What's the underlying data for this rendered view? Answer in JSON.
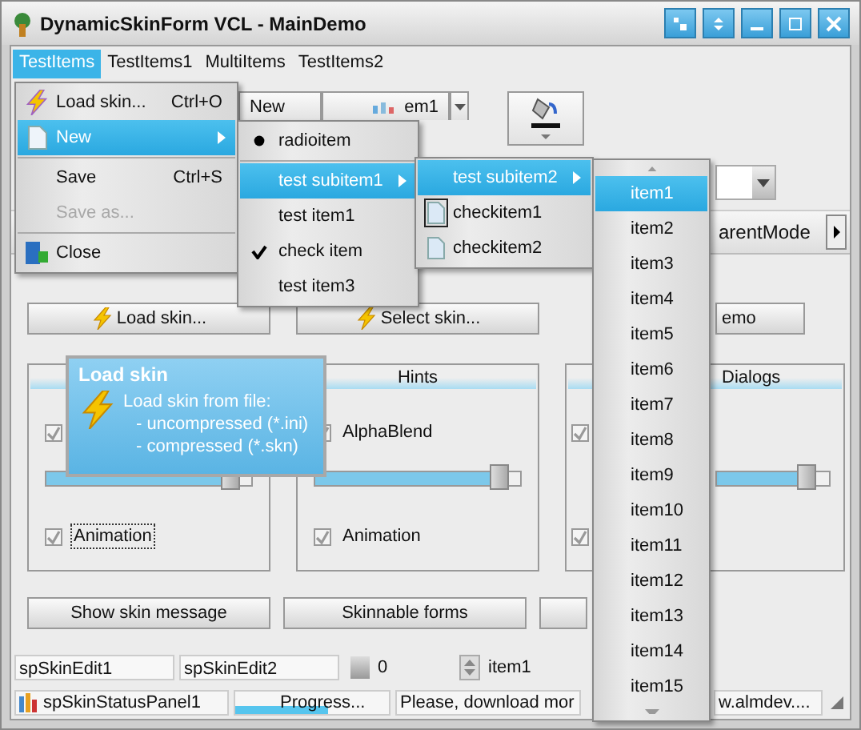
{
  "window": {
    "title": "DynamicSkinForm VCL - MainDemo"
  },
  "menubar": [
    {
      "label": "TestItems",
      "selected": true
    },
    {
      "label": "TestItems1",
      "selected": false
    },
    {
      "label": "MultiItems",
      "selected": false
    },
    {
      "label": "TestItems2",
      "selected": false
    }
  ],
  "toolbar": {
    "new_button": "New",
    "split_button": "em1"
  },
  "mode_bar": {
    "label": "arentMode"
  },
  "action_buttons": [
    {
      "label": "Load skin...",
      "kind": "bolt"
    },
    {
      "label": "Select skin...",
      "kind": "bolt"
    },
    {
      "label": "emo",
      "kind": "plain"
    }
  ],
  "groups": [
    {
      "checkboxes": [
        {
          "checked": true
        },
        {
          "label": "Animation",
          "checked": true,
          "focused": true
        }
      ],
      "slider": {
        "level": 0.9
      }
    },
    {
      "title": "Hints",
      "checkboxes": [
        {
          "label": "AlphaBlend",
          "checked": true,
          "focused": false
        },
        {
          "label": "Animation",
          "checked": true,
          "focused": false
        }
      ],
      "slider": {
        "level": 0.9
      }
    },
    {
      "title": "Dialogs",
      "checkboxes": [
        {
          "checked": true
        },
        {
          "checked": true
        }
      ],
      "slider": {
        "level": 0.8
      }
    }
  ],
  "bottom_buttons": [
    {
      "kind": "text",
      "label": "Show skin message"
    },
    {
      "kind": "text",
      "label": "Skinnable forms"
    },
    {
      "kind": "blank"
    }
  ],
  "edits": {
    "edit1": "spSkinEdit1",
    "edit2": "spSkinEdit2",
    "spin_value": "0",
    "updown_value": "item1"
  },
  "status_bar": {
    "panel": "spSkinStatusPanel1",
    "progress": {
      "label": "Progress...",
      "level": 0.6
    },
    "message": "Please, download mor",
    "message_tail": "w.almdev...."
  },
  "file_menu": [
    {
      "kind": "bolt",
      "label": "Load skin...",
      "shortcut": "Ctrl+O",
      "selected": false,
      "disabled": false,
      "submenu": false
    },
    {
      "kind": "page",
      "label": "New",
      "selected": true,
      "disabled": false,
      "submenu": true
    },
    {
      "kind": "separator"
    },
    {
      "kind": "plain",
      "label": "Save",
      "shortcut": "Ctrl+S",
      "selected": false,
      "disabled": false,
      "submenu": false
    },
    {
      "kind": "plain",
      "label": "Save as...",
      "selected": false,
      "disabled": true,
      "submenu": false
    },
    {
      "kind": "separator"
    },
    {
      "kind": "door",
      "label": "Close",
      "selected": false,
      "disabled": false,
      "submenu": false
    }
  ],
  "sub_menu": [
    {
      "kind": "radio",
      "label": "radioitem",
      "checked": true,
      "selected": false
    },
    {
      "kind": "separator"
    },
    {
      "kind": "item",
      "label": "test subitem1",
      "selected": true,
      "submenu": true
    },
    {
      "kind": "item",
      "label": "test item1",
      "selected": false,
      "submenu": false
    },
    {
      "kind": "check",
      "label": "check item",
      "checked": true,
      "selected": false
    },
    {
      "kind": "item",
      "label": "test item3",
      "selected": false,
      "submenu": false
    }
  ],
  "sub_menu2": [
    {
      "kind": "item",
      "label": "test subitem2",
      "selected": true,
      "submenu": true
    },
    {
      "kind": "icon_check",
      "label": "checkitem1",
      "checked": true,
      "selected": false
    },
    {
      "kind": "icon_check",
      "label": "checkitem2",
      "checked": false,
      "selected": false
    }
  ],
  "item_list": [
    {
      "label": "item1",
      "selected": true
    },
    {
      "label": "item2",
      "selected": false
    },
    {
      "label": "item3",
      "selected": false
    },
    {
      "label": "item4",
      "selected": false
    },
    {
      "label": "item5",
      "selected": false
    },
    {
      "label": "item6",
      "selected": false
    },
    {
      "label": "item7",
      "selected": false
    },
    {
      "label": "item8",
      "selected": false
    },
    {
      "label": "item9",
      "selected": false
    },
    {
      "label": "item10",
      "selected": false
    },
    {
      "label": "item11",
      "selected": false
    },
    {
      "label": "item12",
      "selected": false
    },
    {
      "label": "item13",
      "selected": false
    },
    {
      "label": "item14",
      "selected": false
    },
    {
      "label": "item15",
      "selected": false
    }
  ],
  "hint": {
    "title": "Load skin",
    "lines": [
      "Load skin from file:",
      "- uncompressed (*.ini)",
      "- compressed (*.skn)"
    ]
  }
}
